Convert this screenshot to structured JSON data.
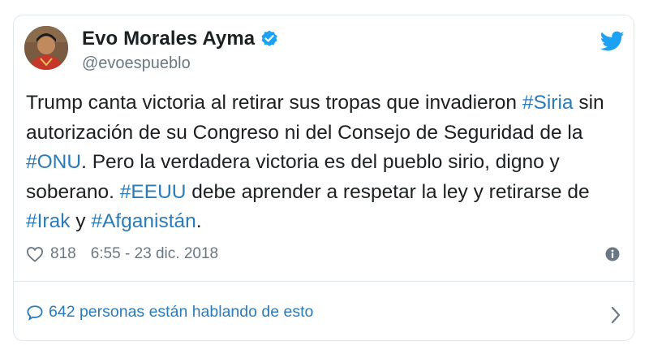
{
  "author": {
    "display_name": "Evo Morales Ayma",
    "handle": "@evoespueblo",
    "verified": true
  },
  "tweet": {
    "segments": [
      {
        "text": "Trump canta victoria al retirar sus tropas que invadieron ",
        "type": "text"
      },
      {
        "text": "#Siria",
        "type": "hashtag"
      },
      {
        "text": " sin autorización de su Congreso ni del Consejo de Seguridad de la ",
        "type": "text"
      },
      {
        "text": "#ONU",
        "type": "hashtag"
      },
      {
        "text": ". Pero la verdadera victoria es del pueblo sirio, digno y soberano. ",
        "type": "text"
      },
      {
        "text": "#EEUU",
        "type": "hashtag"
      },
      {
        "text": " debe aprender a respetar la ley y retirarse de ",
        "type": "text"
      },
      {
        "text": "#Irak",
        "type": "hashtag"
      },
      {
        "text": " y ",
        "type": "text"
      },
      {
        "text": "#Afganistán",
        "type": "hashtag"
      },
      {
        "text": ".",
        "type": "text"
      }
    ]
  },
  "meta": {
    "likes": "818",
    "timestamp": "6:55 - 23 dic. 2018"
  },
  "conversation": {
    "label": "642 personas están hablando de esto"
  },
  "icons": {
    "heart": "heart-icon",
    "info": "info-icon",
    "bubble": "speech-bubble-icon",
    "chevron": "chevron-right-icon",
    "twitter": "twitter-bird-icon",
    "verified": "verified-badge-icon"
  },
  "colors": {
    "link": "#2b7bb9",
    "twitter_blue": "#1da1f2",
    "muted": "#697882",
    "border": "#e1e8ed"
  }
}
